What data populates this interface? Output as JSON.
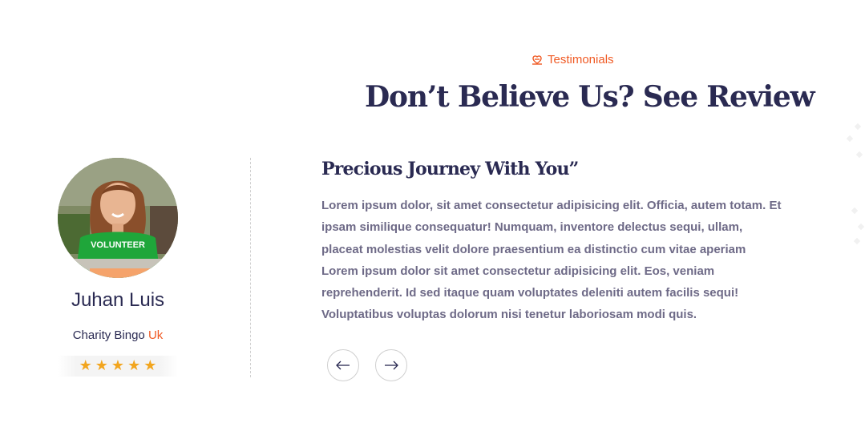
{
  "section": {
    "eyebrow_label": "Testimonials",
    "eyebrow_icon": "charity-icon",
    "headline": "Don’t Believe Us? See Review"
  },
  "testimonial": {
    "avatar_alt": "avatar",
    "person_name": "Juhan Luis",
    "role_prefix": "Charity Bingo",
    "role_accent": "Uk",
    "rating": 5,
    "stars": [
      "★",
      "★",
      "★",
      "★",
      "★"
    ],
    "quote_title": "Precious Journey With You”",
    "quote_body_lines": [
      "Lorem ipsum dolor, sit amet consectetur adipisicing elit. Officia, autem totam. Et",
      "ipsam similique consequatur! Numquam, inventore delectus sequi, ullam,",
      "placeat molestias velit dolore praesentium ea distinctio cum vitae aperiam",
      "Lorem ipsum dolor sit amet consectetur adipisicing elit. Eos, veniam",
      "reprehenderit. Id sed itaque quam voluptates deleniti autem facilis sequi!",
      "Voluptatibus voluptas dolorum nisi tenetur laboriosam modi quis."
    ]
  },
  "navigation": {
    "prev_icon": "arrow-left-icon",
    "next_icon": "arrow-right-icon"
  },
  "colors": {
    "accent": "#f05a24",
    "heading": "#2a2a52",
    "body_text": "#6e6a87",
    "star": "#f2a51e"
  }
}
